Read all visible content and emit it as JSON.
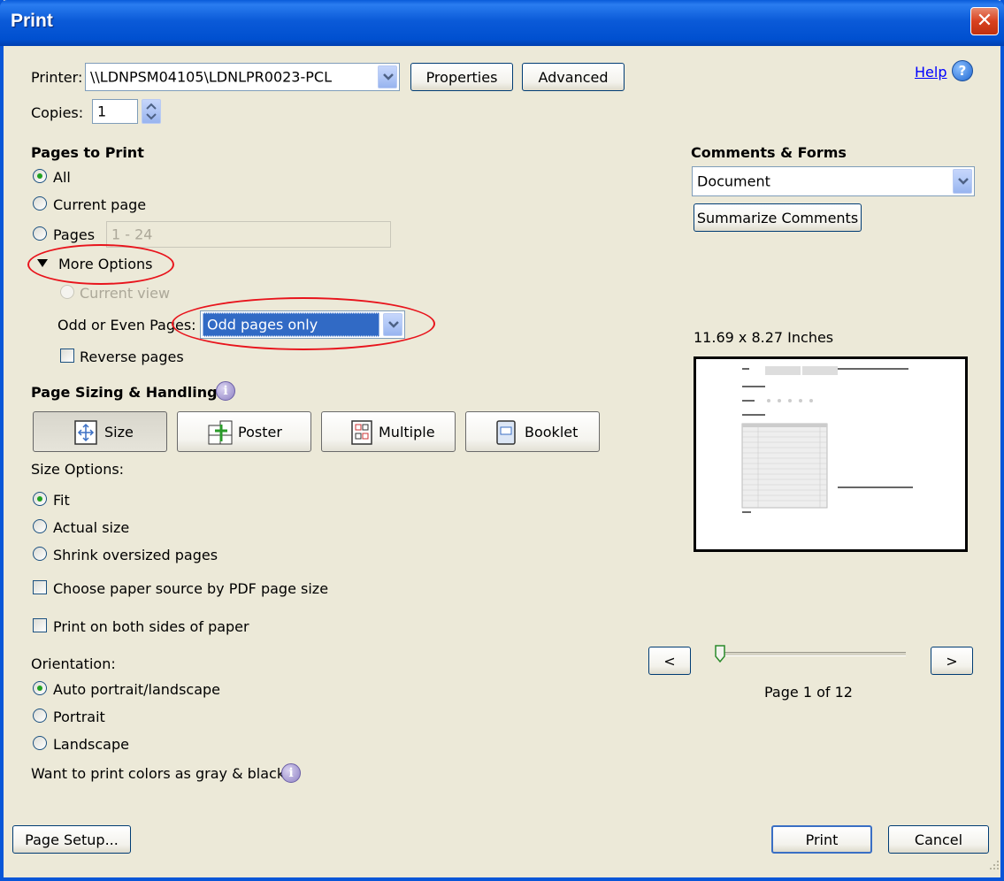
{
  "window": {
    "title": "Print",
    "close_glyph": "✕"
  },
  "printer": {
    "label": "Printer:",
    "value": "\\\\LDNPSM04105\\LDNLPR0023-PCL",
    "properties_label": "Properties",
    "advanced_label": "Advanced"
  },
  "help": {
    "label": "Help"
  },
  "copies": {
    "label": "Copies:",
    "value": "1"
  },
  "pages_to_print": {
    "heading": "Pages to Print",
    "all": "All",
    "current_page": "Current page",
    "pages": "Pages",
    "pages_range": "1 - 24",
    "more_options": "More Options",
    "current_view": "Current view",
    "odd_even_label": "Odd or Even Pages:",
    "odd_even_value": "Odd pages only",
    "reverse_pages": "Reverse pages"
  },
  "sizing": {
    "heading": "Page Sizing & Handling",
    "size": "Size",
    "poster": "Poster",
    "multiple": "Multiple",
    "booklet": "Booklet",
    "size_options_label": "Size Options:",
    "fit": "Fit",
    "actual_size": "Actual size",
    "shrink": "Shrink oversized pages",
    "choose_paper": "Choose paper source by PDF page size",
    "both_sides": "Print on both sides of paper"
  },
  "orientation": {
    "label": "Orientation:",
    "auto": "Auto portrait/landscape",
    "portrait": "Portrait",
    "landscape": "Landscape"
  },
  "gray_question": "Want to print colors as gray & black?",
  "comments_forms": {
    "heading": "Comments & Forms",
    "value": "Document",
    "summarize_label": "Summarize Comments"
  },
  "preview": {
    "dimensions": "11.69 x 8.27 Inches",
    "prev_label": "<",
    "next_label": ">",
    "page_indicator": "Page 1 of 12"
  },
  "footer": {
    "page_setup": "Page Setup...",
    "print": "Print",
    "cancel": "Cancel"
  },
  "colors": {
    "title_bar": "#0a5bd9",
    "dialog_bg": "#ece9d8",
    "annotation_red": "#e8141c",
    "selection_blue": "#316ac5",
    "radio_selected": "#21a121"
  },
  "icons": {
    "close": "close-icon",
    "help": "help-icon",
    "size": "size-icon",
    "poster": "poster-icon",
    "multiple": "multiple-icon",
    "booklet": "booklet-icon",
    "info": "info-icon"
  }
}
